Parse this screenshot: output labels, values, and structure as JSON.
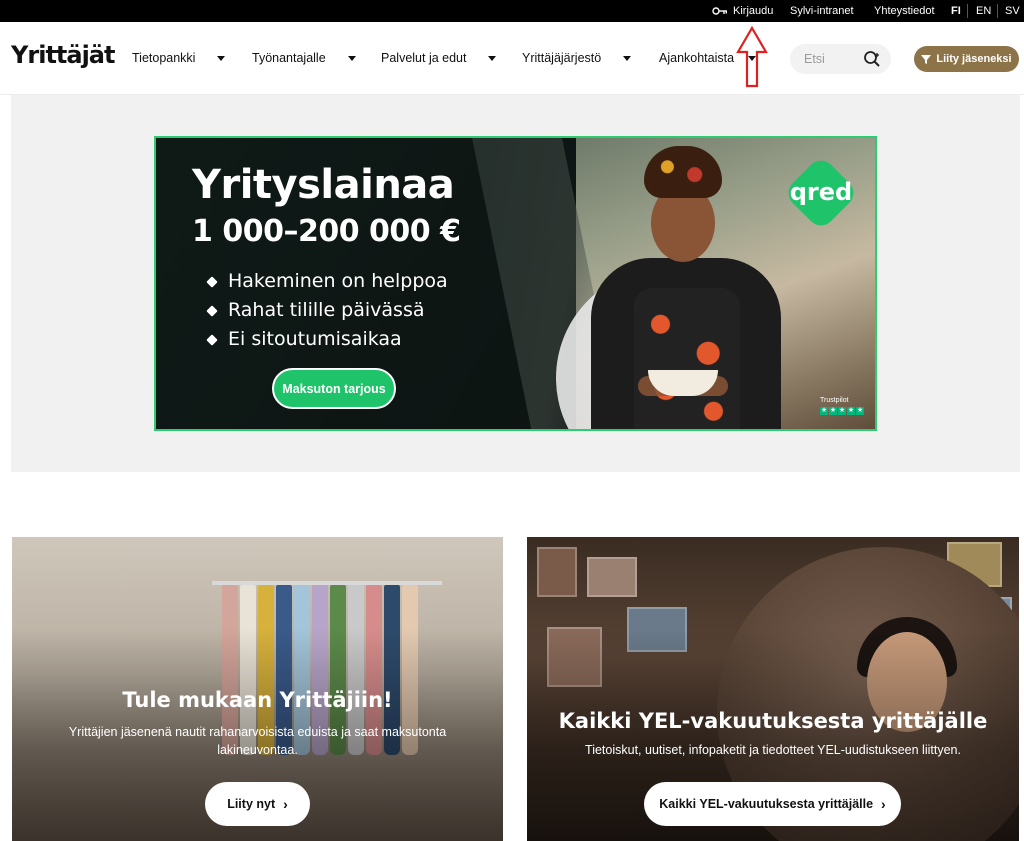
{
  "topbar": {
    "login": "Kirjaudu",
    "intranet": "Sylvi-intranet",
    "contact": "Yhteystiedot",
    "lang_fi": "FI",
    "lang_en": "EN",
    "lang_sv": "SV",
    "login_icon": "key-icon"
  },
  "header": {
    "logo": "Yrittäjät",
    "nav": [
      {
        "label": "Tietopankki"
      },
      {
        "label": "Työnantajalle"
      },
      {
        "label": "Palvelut ja edut"
      },
      {
        "label": "Yrittäjäjärjestö"
      },
      {
        "label": "Ajankohtaista"
      }
    ],
    "search_placeholder": "Etsi",
    "join_label": "Liity jäseneksi"
  },
  "ad": {
    "title": "Yrityslainaa",
    "range": "1 000–200 000 €",
    "bullets": [
      "Hakeminen on helppoa",
      "Rahat tilille päivässä",
      "Ei sitoutumisaikaa"
    ],
    "cta": "Maksuton tarjous",
    "brand": "qred",
    "trustpilot": "Trustpilot",
    "accent_color": "#1ec36a"
  },
  "cards": [
    {
      "title": "Tule mukaan Yrittäjiin!",
      "desc": "Yrittäjien jäsenenä nautit rahanarvoisista eduista ja saat maksutonta lakineuvontaa.",
      "button": "Liity nyt"
    },
    {
      "title": "Kaikki YEL-vakuutuksesta yrittäjälle",
      "desc": "Tietoiskut, uutiset, infopaketit ja tiedotteet YEL-uudistukseen liittyen.",
      "button": "Kaikki YEL-vakuutuksesta yrittäjälle"
    }
  ],
  "colors": {
    "topbar_bg": "#000000",
    "brand_gold": "#8c7448",
    "annotation_red": "#e02020"
  }
}
